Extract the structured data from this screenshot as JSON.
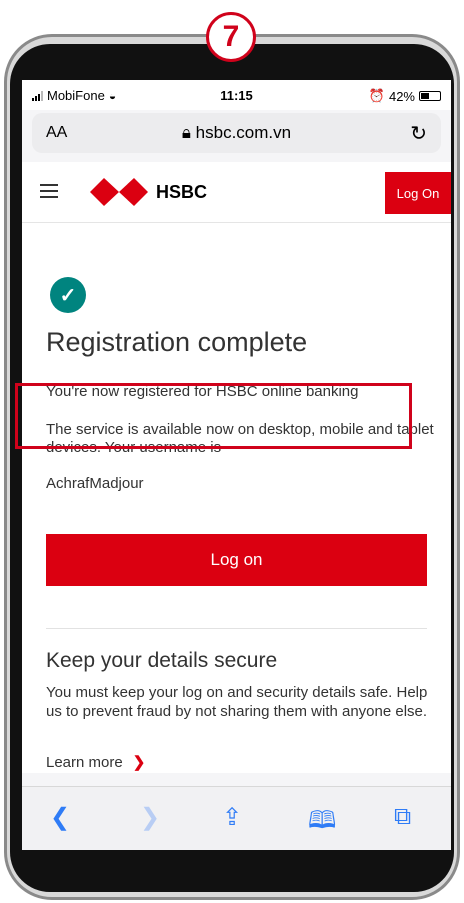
{
  "step_number": "7",
  "status_bar": {
    "carrier": "MobiFone",
    "time": "11:15",
    "battery": "42%"
  },
  "url_bar": {
    "text_size": "AA",
    "url": "hsbc.com.vn"
  },
  "header": {
    "brand": "HSBC",
    "logon_label": "Log On"
  },
  "content": {
    "title": "Registration complete",
    "registered_text": "You're now registered for HSBC online banking",
    "service_text": "The service is available now on desktop, mobile and tablet devices. Your username is",
    "username": "AchrafMadjour",
    "logon_button": "Log on",
    "secure_title": "Keep your details secure",
    "secure_text": "You must keep your log on and security details safe. Help us to prevent fraud by not sharing them with anyone else.",
    "learn_more": "Learn more"
  },
  "colors": {
    "brand_red": "#db0011",
    "success_teal": "#00847f",
    "ios_blue": "#2f7cf6",
    "annotation_red": "#d0021b"
  }
}
